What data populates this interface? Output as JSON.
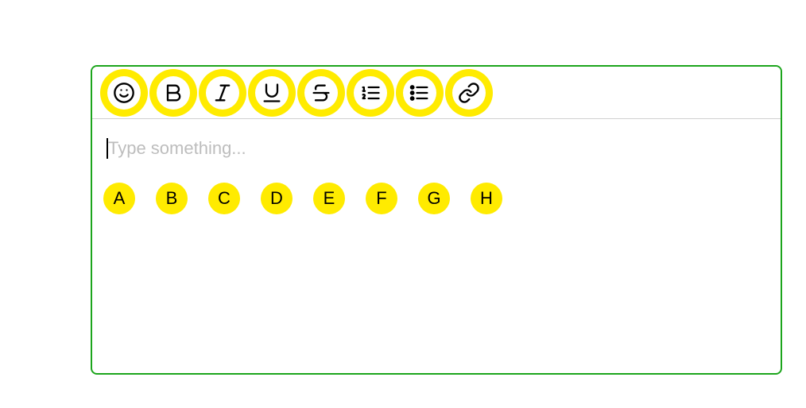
{
  "editor": {
    "placeholder": "Type something..."
  },
  "toolbar": {
    "items": [
      {
        "name": "emoji-icon"
      },
      {
        "name": "bold-icon"
      },
      {
        "name": "italic-icon"
      },
      {
        "name": "underline-icon"
      },
      {
        "name": "strikethrough-icon"
      },
      {
        "name": "ordered-list-icon"
      },
      {
        "name": "unordered-list-icon"
      },
      {
        "name": "link-icon"
      }
    ]
  },
  "badges": {
    "letters": [
      "A",
      "B",
      "C",
      "D",
      "E",
      "F",
      "G",
      "H"
    ]
  }
}
